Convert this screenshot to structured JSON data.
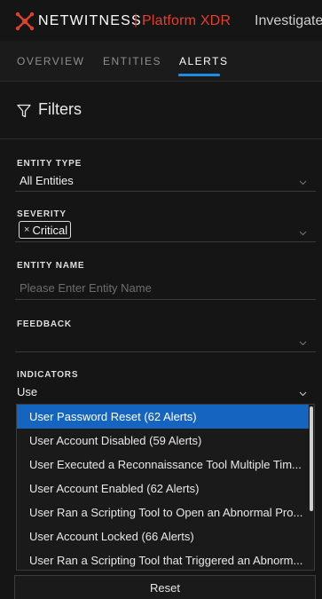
{
  "header": {
    "brand": "NETWITNESS",
    "separator": "|",
    "product": "Platform XDR",
    "nav_link": "Investigate"
  },
  "tabs": [
    {
      "label": "OVERVIEW"
    },
    {
      "label": "ENTITIES"
    },
    {
      "label": "ALERTS"
    }
  ],
  "active_tab": "ALERTS",
  "filters": {
    "title": "Filters",
    "entity_type": {
      "label": "ENTITY TYPE",
      "value": "All Entities"
    },
    "severity": {
      "label": "SEVERITY",
      "chip": "Critical",
      "chip_remove": "×"
    },
    "entity_name": {
      "label": "ENTITY NAME",
      "placeholder": "Please Enter Entity Name"
    },
    "feedback": {
      "label": "FEEDBACK",
      "value": ""
    },
    "indicators": {
      "label": "INDICATORS",
      "value": "Use",
      "options": [
        "User Password Reset (62 Alerts)",
        "User Account Disabled (59 Alerts)",
        "User Executed a Reconnaissance Tool Multiple Tim...",
        "User Account Enabled (62 Alerts)",
        "User Ran a Scripting Tool to Open an Abnormal Pro...",
        "User Account Locked (66 Alerts)",
        "User Ran a Scripting Tool that Triggered an Abnorm..."
      ],
      "selected_index": 0
    }
  },
  "reset_label": "Reset",
  "colors": {
    "accent": "#1c8ce6",
    "brand_red": "#e0412f",
    "selected_bg": "#1565c0",
    "background": "#151515"
  },
  "icons": {
    "logo": "netwitness-logo-icon",
    "filter": "filter-funnel-icon",
    "chevron": "chevron-down-icon"
  }
}
